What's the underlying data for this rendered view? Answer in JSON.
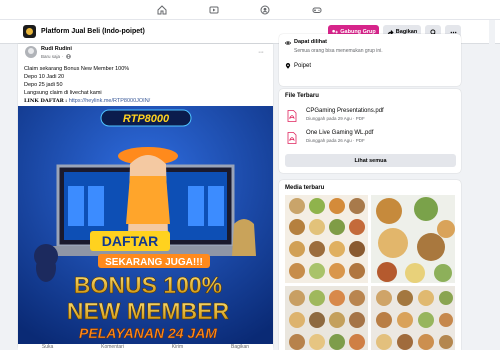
{
  "group": {
    "title": "Platform Jual Beli (Indo-poipet)",
    "join_label": "Gabung Grup",
    "share_label": "Bagikan"
  },
  "post": {
    "author": "Rudi Rudini",
    "timestamp": "Baru saja",
    "lines": [
      "Claim sekarang Bonus New Member 100%",
      "Depo 10 Jadi 20",
      "Depo 25 jadi 50",
      "Langsung claim di livechat kami"
    ],
    "link_label": "LINK DAFTAR",
    "link_sep": ":",
    "link_url": "https://heylink.me/RTP8000JOIN/",
    "banner": {
      "logo": "RTP8000",
      "daftar": "DAFTAR",
      "sekarang": "SEKARANG JUGA!!!",
      "bonus1": "BONUS 100%",
      "bonus2": "NEW MEMBER",
      "service": "PELAYANAN 24 JAM"
    },
    "actions": [
      "Suka",
      "Komentari",
      "Kirim",
      "Bagikan"
    ]
  },
  "sidebar": {
    "about": {
      "visible_title": "Dapat dilihat",
      "visible_desc": "Semua orang bisa menemukan grup ini.",
      "location": "Poipet"
    },
    "files": {
      "title": "File Terbaru",
      "items": [
        {
          "name": "CPGaming Presentations.pdf",
          "meta": "Diunggah pada 29 Agu · PDF"
        },
        {
          "name": "One Live Gaming WL.pdf",
          "meta": "Diunggah pada 26 Agu · PDF"
        }
      ],
      "see_all": "Lihat semua"
    },
    "media": {
      "title": "Media terbaru"
    }
  },
  "colors": {
    "accent": "#d6248a",
    "banner_blue": "#12398f",
    "banner_yellow": "#ffd21f",
    "banner_orange": "#ff8a1c"
  },
  "icons": [
    "home-icon",
    "video-icon",
    "groups-icon",
    "gaming-icon",
    "join-group-icon",
    "share-icon",
    "search-icon",
    "more-icon",
    "globe-icon",
    "eye-icon",
    "location-icon",
    "pdf-icon"
  ]
}
